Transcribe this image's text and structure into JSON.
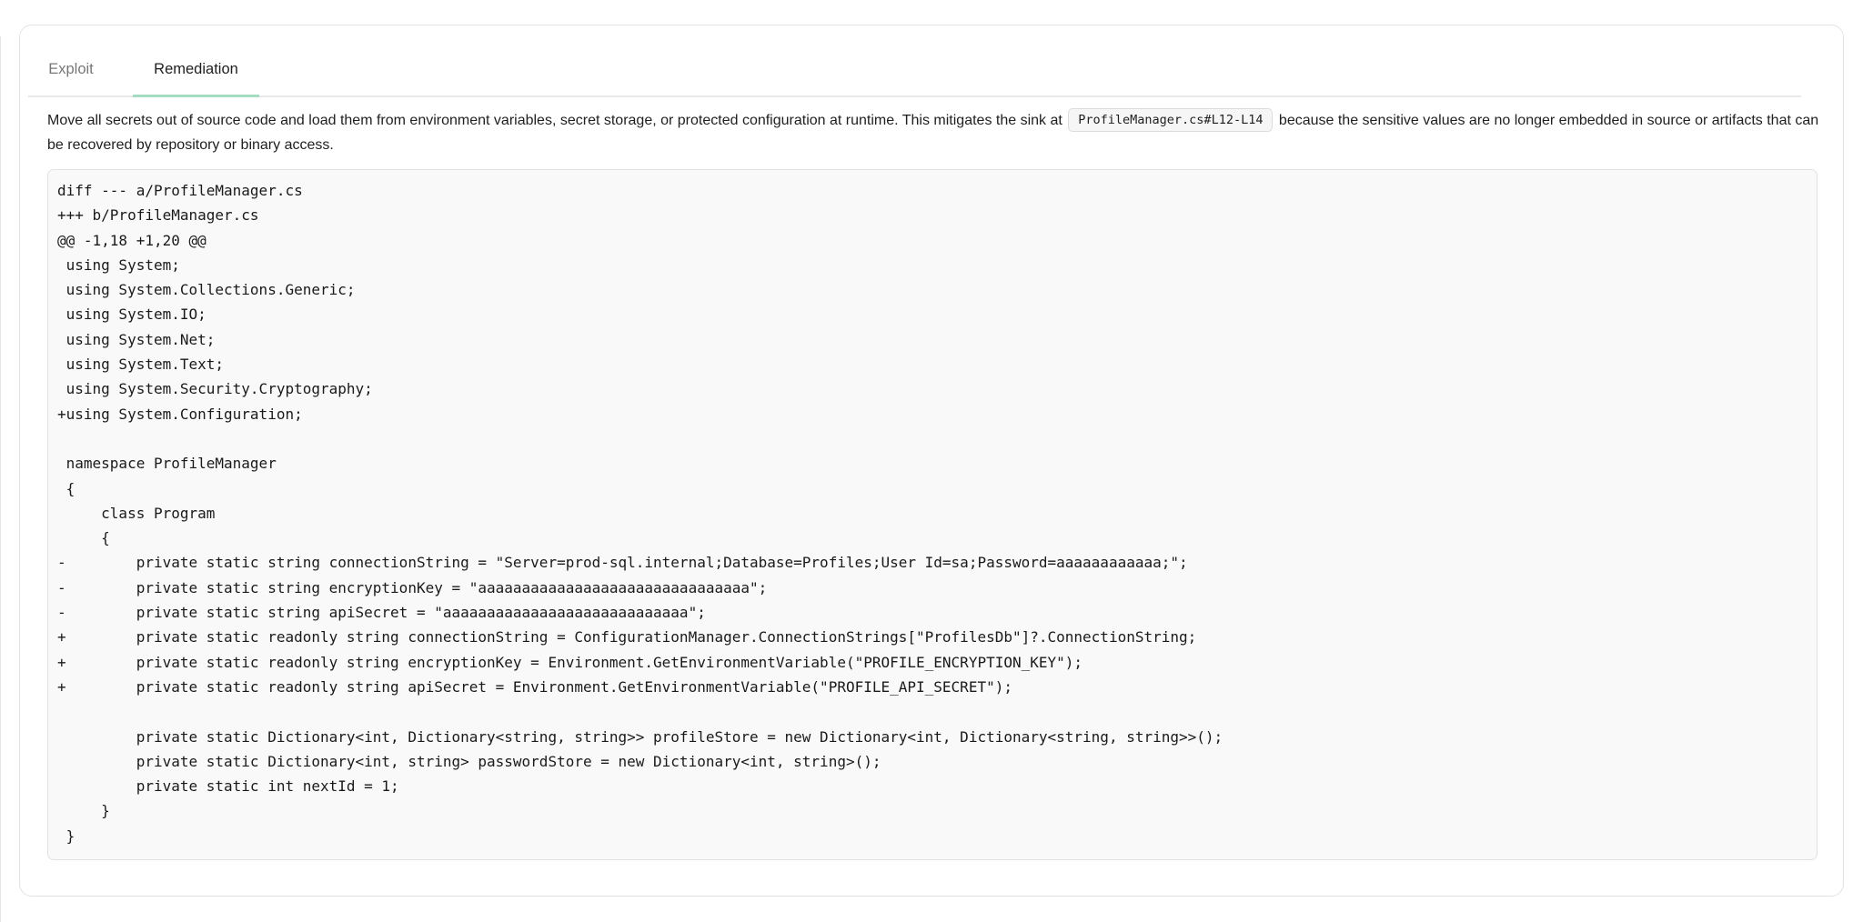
{
  "tabs": [
    {
      "label": "Exploit",
      "active": false
    },
    {
      "label": "Remediation",
      "active": true
    }
  ],
  "description": {
    "before": "Move all secrets out of source code and load them from environment variables, secret storage, or protected configuration at runtime. This mitigates the sink at ",
    "code_ref": "ProfileManager.cs#L12-L14",
    "after": " because the sensitive values are no longer embedded in source or artifacts that can be recovered by repository or binary access."
  },
  "diff": {
    "lines": [
      "diff --- a/ProfileManager.cs",
      "+++ b/ProfileManager.cs",
      "@@ -1,18 +1,20 @@",
      " using System;",
      " using System.Collections.Generic;",
      " using System.IO;",
      " using System.Net;",
      " using System.Text;",
      " using System.Security.Cryptography;",
      "+using System.Configuration;",
      "",
      " namespace ProfileManager",
      " {",
      "     class Program",
      "     {",
      "-        private static string connectionString = \"Server=prod-sql.internal;Database=Profiles;User Id=sa;Password=aaaaaaaaaaaa;\";",
      "-        private static string encryptionKey = \"aaaaaaaaaaaaaaaaaaaaaaaaaaaaaaa\";",
      "-        private static string apiSecret = \"aaaaaaaaaaaaaaaaaaaaaaaaaaaa\";",
      "+        private static readonly string connectionString = ConfigurationManager.ConnectionStrings[\"ProfilesDb\"]?.ConnectionString;",
      "+        private static readonly string encryptionKey = Environment.GetEnvironmentVariable(\"PROFILE_ENCRYPTION_KEY\");",
      "+        private static readonly string apiSecret = Environment.GetEnvironmentVariable(\"PROFILE_API_SECRET\");",
      "",
      "         private static Dictionary<int, Dictionary<string, string>> profileStore = new Dictionary<int, Dictionary<string, string>>();",
      "         private static Dictionary<int, string> passwordStore = new Dictionary<int, string>();",
      "         private static int nextId = 1;",
      "     }",
      " }"
    ]
  },
  "colors": {
    "active_tab_underline": "#a3dcc0",
    "inactive_tab_text": "#777777",
    "code_background": "#f9f9f9"
  }
}
